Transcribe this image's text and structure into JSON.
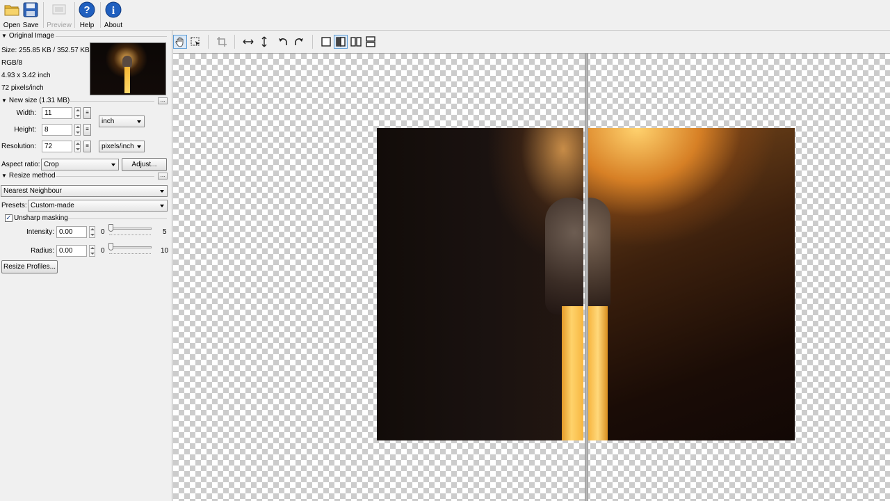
{
  "toolbar": {
    "buttons": [
      {
        "label": "Open",
        "icon": "folder-icon",
        "enabled": true
      },
      {
        "label": "Save",
        "icon": "floppy-disk-icon",
        "enabled": true
      },
      {
        "label": "Preview",
        "icon": "preview-icon",
        "enabled": false
      },
      {
        "label": "Help",
        "icon": "help-icon",
        "enabled": true
      },
      {
        "label": "About",
        "icon": "info-icon",
        "enabled": true
      }
    ]
  },
  "original_image": {
    "header": "Original Image",
    "size": "Size: 255.85 KB / 352.57 KB",
    "color_mode": "RGB/8",
    "dimensions": "4.93 x 3.42 inch",
    "resolution": "72 pixels/inch",
    "more_button": "..."
  },
  "new_size": {
    "header": "New size (1.31 MB)",
    "more_button": "...",
    "width_label": "Width:",
    "width_value": "11",
    "height_label": "Height:",
    "height_value": "8",
    "unit": "inch",
    "resolution_label": "Resolution:",
    "resolution_value": "72",
    "resolution_unit": "pixels/inch",
    "aspect_label": "Aspect ratio:",
    "aspect_value": "Crop",
    "adjust_button": "Adjust..."
  },
  "resize_method": {
    "header": "Resize method",
    "more_button": "...",
    "method": "Nearest Neighbour",
    "presets_label": "Presets:",
    "preset_value": "Custom-made",
    "unsharp_label": "Unsharp masking",
    "unsharp_checked": true,
    "intensity_label": "Intensity:",
    "intensity_value": "0.00",
    "intensity_min": "0",
    "intensity_max": "5",
    "radius_label": "Radius:",
    "radius_value": "0.00",
    "radius_min": "0",
    "radius_max": "10",
    "profiles_button": "Resize Profiles..."
  },
  "view_toolbar": {
    "tools": [
      "hand-tool-icon",
      "selection-tool-icon",
      "crop-icon",
      "flip-horizontal-icon",
      "flip-vertical-icon",
      "rotate-left-icon",
      "rotate-right-icon",
      "single-view-icon",
      "split-view-icon",
      "side-by-side-icon",
      "top-bottom-icon"
    ],
    "active": [
      "hand-tool-icon",
      "split-view-icon"
    ]
  },
  "colors": {
    "accent": "#5b9bd5",
    "help_icon": "#1f5fbf",
    "folder": "#e8b83a"
  }
}
